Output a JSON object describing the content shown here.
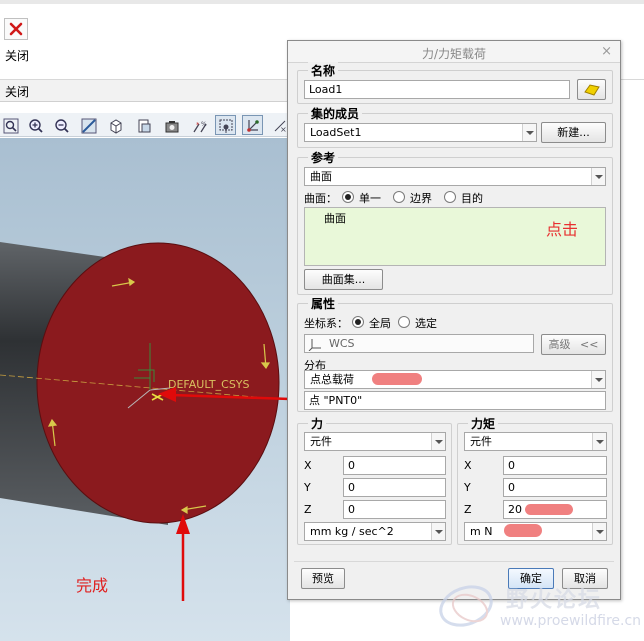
{
  "ribbon": {
    "close_label": "关闭",
    "group_label": "关闭"
  },
  "toolbar": {
    "icons": [
      "zoom-fit-icon",
      "zoom-in-icon",
      "zoom-out-icon",
      "repaint-icon",
      "view-orientation-icon",
      "saved-views-icon",
      "display-style-icon",
      "spin-center-icon",
      "datum-display-icon",
      "csys-display-icon"
    ]
  },
  "viewport": {
    "csys_label": "DEFAULT_CSYS",
    "done_annotation": "完成",
    "load_surface_color": "#8b1a1e"
  },
  "dialog": {
    "title": "力/力矩载荷",
    "close_glyph": "×",
    "name": {
      "section": "名称",
      "value": "Load1"
    },
    "set": {
      "section": "集的成员",
      "value": "LoadSet1",
      "new_button": "新建..."
    },
    "reference": {
      "section": "参考",
      "type_value": "曲面",
      "surface_label": "曲面：",
      "options": [
        "单一",
        "边界",
        "目的"
      ],
      "selected_option": "单一",
      "list_items": [
        "曲面"
      ],
      "click_annotation": "点击",
      "surface_set_button": "曲面集..."
    },
    "properties": {
      "section": "属性",
      "csys_label": "坐标系：",
      "csys_options": [
        "全局",
        "选定"
      ],
      "csys_selected": "全局",
      "csys_value": "WCS",
      "advanced_button": "高级",
      "advanced_chevron": "<<",
      "distribution_label": "分布",
      "distribution_value": "点总载荷",
      "point_value": "点 \"PNT0\""
    },
    "force": {
      "section": "力",
      "mode": "元件",
      "x_label": "X",
      "x": "0",
      "y_label": "Y",
      "y": "0",
      "z_label": "Z",
      "z": "0",
      "units": "mm kg / sec^2"
    },
    "moment": {
      "section": "力矩",
      "mode": "元件",
      "x_label": "X",
      "x": "0",
      "y_label": "Y",
      "y": "0",
      "z_label": "Z",
      "z": "20",
      "units": "m N"
    },
    "footer": {
      "preview_button": "预览",
      "ok_button": "确定",
      "cancel_button": "取消"
    }
  },
  "watermark": {
    "title": "野火论坛",
    "url": "www.proewildfire.cn"
  }
}
